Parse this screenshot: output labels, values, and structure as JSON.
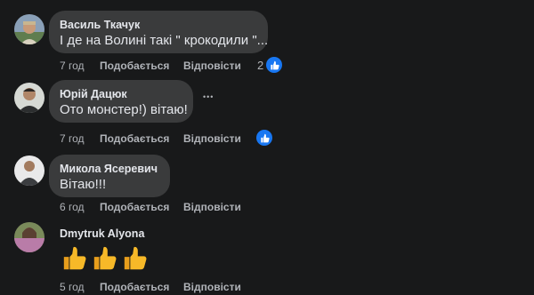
{
  "comments": [
    {
      "author": "Василь Ткачук",
      "text": "І де на Волині такі \" крокодили \"...",
      "time": "7 год",
      "like_label": "Подобається",
      "reply_label": "Відповісти",
      "reaction_count": "2",
      "reaction_icon": "thumbs-up-icon"
    },
    {
      "author": "Юрій Дацюк",
      "text": "Ото монстер!) вітаю!",
      "time": "7 год",
      "like_label": "Подобається",
      "reply_label": "Відповісти",
      "more_label": "•••",
      "reaction_icon": "thumbs-up-icon"
    },
    {
      "author": "Микола Ясеревич",
      "text": "Вітаю!!!",
      "time": "6 год",
      "like_label": "Подобається",
      "reply_label": "Відповісти"
    },
    {
      "author": "Dmytruk Alyona",
      "emojis": [
        "thumbs-up-emoji",
        "thumbs-up-emoji",
        "thumbs-up-emoji"
      ],
      "time": "5 год",
      "like_label": "Подобається",
      "reply_label": "Відповісти"
    }
  ],
  "colors": {
    "background": "#18191a",
    "bubble": "#3a3b3c",
    "text": "#e4e6eb",
    "secondary": "#b0b3b8",
    "like_blue": "#1877f2",
    "emoji_yellow": "#f7b928"
  }
}
